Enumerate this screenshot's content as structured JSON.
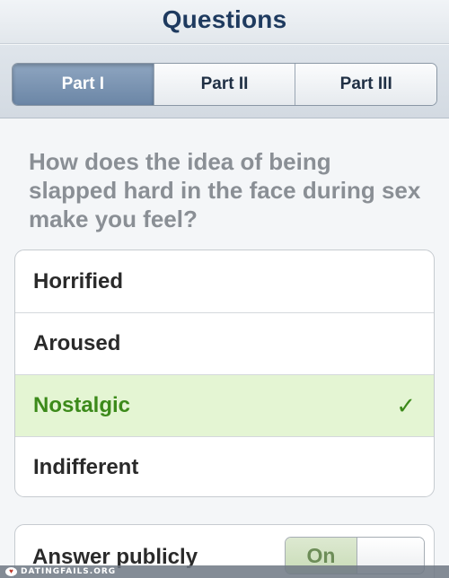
{
  "navbar": {
    "title": "Questions"
  },
  "tabs": [
    {
      "label": "Part I",
      "active": true
    },
    {
      "label": "Part II",
      "active": false
    },
    {
      "label": "Part III",
      "active": false
    }
  ],
  "question": {
    "text": "How does the idea of being slapped hard in the face during sex make you feel?"
  },
  "options": [
    {
      "label": "Horrified",
      "selected": false
    },
    {
      "label": "Aroused",
      "selected": false
    },
    {
      "label": "Nostalgic",
      "selected": true,
      "check_glyph": "✓"
    },
    {
      "label": "Indifferent",
      "selected": false
    }
  ],
  "answer_publicly": {
    "label": "Answer publicly",
    "toggle_text": "On",
    "state": "on"
  },
  "watermark": {
    "text": "DATINGFAILS.ORG",
    "icon": "heart-badge-icon"
  },
  "colors": {
    "title": "#1e3a5f",
    "active_tab": "#7a93b1",
    "selected_bg": "#e4f5d3",
    "selected_text": "#3c8a1a",
    "question_text": "#8a8f95"
  }
}
